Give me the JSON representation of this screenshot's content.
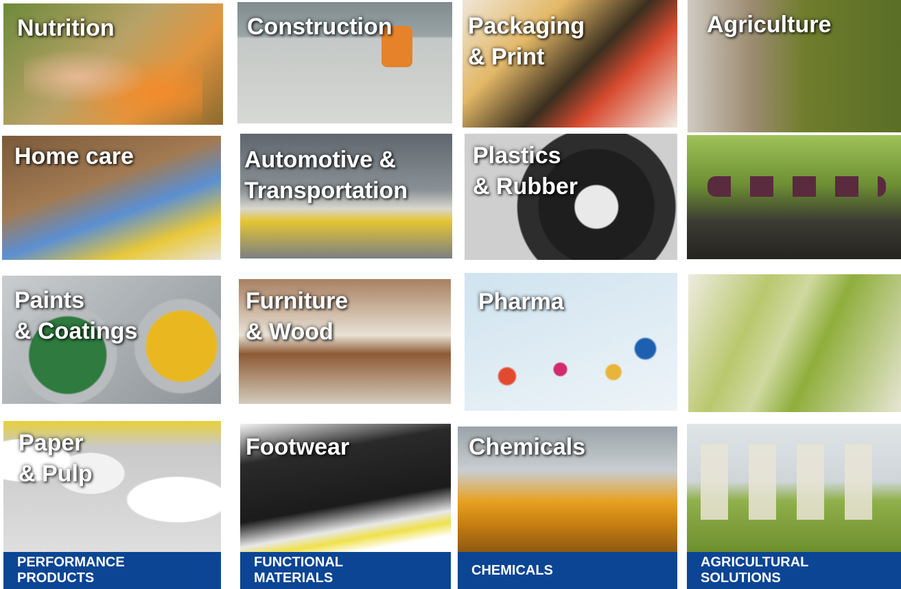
{
  "tiles": [
    {
      "label": [
        "Nutrition"
      ]
    },
    {
      "label": [
        "Construction"
      ]
    },
    {
      "label": [
        "Packaging",
        "& Print"
      ]
    },
    {
      "label": [
        "Agriculture"
      ]
    },
    {
      "label": [
        "Home care"
      ]
    },
    {
      "label": [
        "Automotive &",
        "Transportation"
      ]
    },
    {
      "label": [
        "Plastics",
        "& Rubber"
      ]
    },
    {
      "label": []
    },
    {
      "label": [
        "Paints",
        "& Coatings"
      ]
    },
    {
      "label": [
        "Furniture",
        "& Wood"
      ]
    },
    {
      "label": [
        "Pharma"
      ]
    },
    {
      "label": []
    },
    {
      "label": [
        "Paper",
        "& Pulp"
      ]
    },
    {
      "label": [
        "Footwear"
      ]
    },
    {
      "label": [
        "Chemicals"
      ]
    },
    {
      "label": []
    }
  ],
  "segments": [
    {
      "label": [
        "PERFORMANCE",
        "PRODUCTS"
      ]
    },
    {
      "label": [
        "FUNCTIONAL",
        "MATERIALS"
      ]
    },
    {
      "label": [
        "CHEMICALS"
      ]
    },
    {
      "label": [
        "AGRICULTURAL",
        "SOLUTIONS"
      ]
    }
  ],
  "colors": {
    "banner": "#0b4594",
    "label_text": "#ffffff"
  }
}
